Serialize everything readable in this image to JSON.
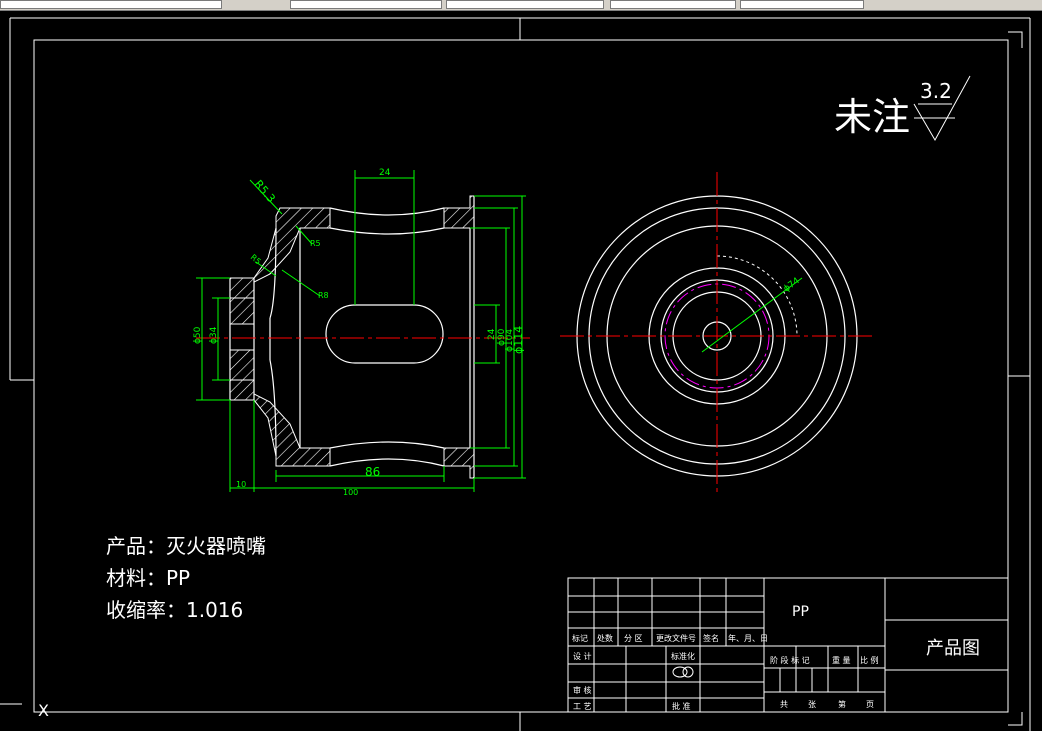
{
  "drawing": {
    "surface_note": "未注",
    "surface_roughness": "3.2",
    "dimensions": {
      "r53": "R5.3",
      "r5a": "R5",
      "r5b": "R5",
      "r8": "R8",
      "d24_top": "24",
      "d24_side": "24",
      "d86": "86",
      "d10": "10",
      "d100": "100",
      "phi50": "ϕ50",
      "phi34": "ϕ34",
      "phi90": "ϕ90",
      "phi104": "ϕ104",
      "phi114": "ϕ114",
      "phi_circle": "ϕ74"
    },
    "notes": {
      "product_label": "产品：灭火器喷嘴",
      "material_label": "材料：PP",
      "shrinkage_label": "收缩率：1.016"
    }
  },
  "title_block": {
    "material": "PP",
    "title": "产品图",
    "headers": [
      "标记",
      "处数",
      "分 区",
      "更改文件号",
      "签名",
      "年、月、日"
    ],
    "design": "设 计",
    "standardize": "标准化",
    "review": "审 核",
    "process": "工 艺",
    "approve": "批 准",
    "stage_mark": "阶 段 标 记",
    "weight": "重 量",
    "scale": "比 例",
    "total": "共",
    "sheets": "张",
    "sheet_no": "第",
    "page": "页"
  },
  "ucs": {
    "label": "X"
  },
  "colors": {
    "dim": "#00ff00",
    "center": "#ff0000",
    "outline": "#ffffff",
    "hidden": "#ff00ff",
    "hatch": "#ffffff"
  }
}
